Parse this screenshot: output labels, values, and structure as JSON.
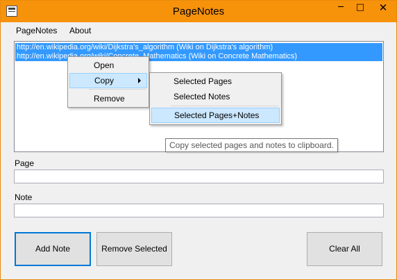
{
  "window": {
    "title": "PageNotes",
    "controls": {
      "minimize": "─",
      "maximize": "□",
      "close": "✕"
    },
    "accent_color": "#f7920b"
  },
  "menubar": {
    "items": [
      "PageNotes",
      "About"
    ]
  },
  "list": {
    "rows": [
      "http://en.wikipedia.org/wiki/Dijkstra's_algorithm (Wiki on Dijkstra's algorithm)",
      "http://en.wikipedia.org/wiki/Concrete_Mathematics (Wiki on Concrete Mathematics)"
    ],
    "selection_color": "#3399ff"
  },
  "fields": {
    "page_label": "Page",
    "page_value": "",
    "note_label": "Note",
    "note_value": ""
  },
  "buttons": {
    "add_note": "Add Note",
    "remove_selected": "Remove Selected",
    "clear_all": "Clear All"
  },
  "context_menu": {
    "open": "Open",
    "copy": "Copy",
    "remove": "Remove"
  },
  "copy_submenu": {
    "selected_pages": "Selected Pages",
    "selected_notes": "Selected Notes",
    "selected_pages_notes": "Selected Pages+Notes"
  },
  "tooltip": {
    "text": "Copy selected pages and notes to clipboard."
  }
}
